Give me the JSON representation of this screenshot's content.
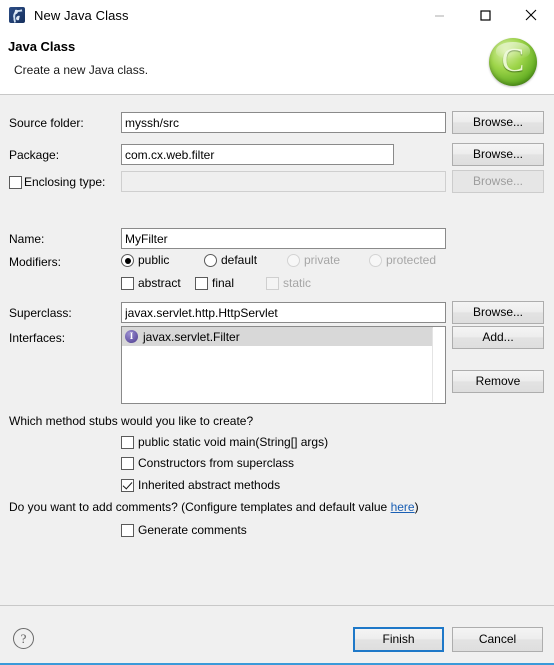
{
  "window": {
    "title": "New Java Class",
    "icon": "java-class-icon",
    "controls": {
      "minimize": "minimize-icon",
      "maximize": "maximize-icon",
      "close": "close-icon"
    }
  },
  "header": {
    "title": "Java Class",
    "description": "Create a new Java class.",
    "banner_icon_letter": "C"
  },
  "form": {
    "source_folder": {
      "label": "Source folder:",
      "value": "myssh/src",
      "browse_label": "Browse...",
      "browse_enabled": true
    },
    "package": {
      "label": "Package:",
      "value": "com.cx.web.filter",
      "browse_label": "Browse...",
      "browse_enabled": true
    },
    "enclosing_type": {
      "label": "Enclosing type:",
      "checked": false,
      "value": "",
      "browse_label": "Browse...",
      "browse_enabled": false
    },
    "name": {
      "label": "Name:",
      "value": "MyFilter"
    },
    "modifiers": {
      "label": "Modifiers:",
      "access": [
        {
          "label": "public",
          "checked": true,
          "enabled": true
        },
        {
          "label": "default",
          "checked": false,
          "enabled": true
        },
        {
          "label": "private",
          "checked": false,
          "enabled": false
        },
        {
          "label": "protected",
          "checked": false,
          "enabled": false
        }
      ],
      "flags": [
        {
          "label": "abstract",
          "checked": false,
          "enabled": true
        },
        {
          "label": "final",
          "checked": false,
          "enabled": true
        },
        {
          "label": "static",
          "checked": false,
          "enabled": false
        }
      ]
    },
    "superclass": {
      "label": "Superclass:",
      "value": "javax.servlet.http.HttpServlet",
      "browse_label": "Browse..."
    },
    "interfaces": {
      "label": "Interfaces:",
      "items": [
        {
          "name": "javax.servlet.Filter",
          "icon": "interface-icon",
          "selected": true
        }
      ],
      "add_label": "Add...",
      "remove_label": "Remove"
    }
  },
  "stubs": {
    "question": "Which method stubs would you like to create?",
    "options": [
      {
        "label": "public static void main(String[] args)",
        "checked": false
      },
      {
        "label": "Constructors from superclass",
        "checked": false
      },
      {
        "label": "Inherited abstract methods",
        "checked": true
      }
    ]
  },
  "comments": {
    "question_prefix": "Do you want to add comments? (Configure templates and default value ",
    "link_label": "here",
    "question_suffix": ")",
    "option": {
      "label": "Generate comments",
      "checked": false
    }
  },
  "footer": {
    "help_icon": "?",
    "finish_label": "Finish",
    "cancel_label": "Cancel"
  },
  "colors": {
    "dialog_bg": "#f0f0f0",
    "header_bg": "#ffffff",
    "accent_blue": "#1e78c8",
    "bottom_border": "#3a9ad9",
    "link": "#1a5fb4",
    "banner_green": "#63ae23",
    "interface_purple": "#6f5fae"
  }
}
